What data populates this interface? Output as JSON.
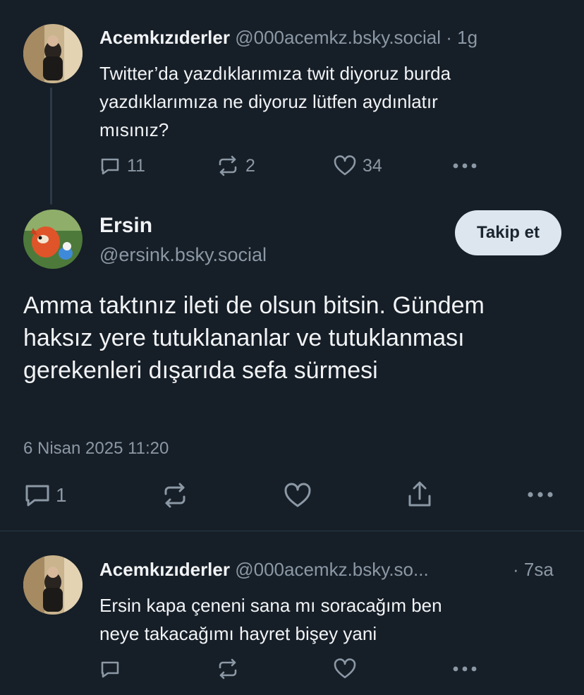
{
  "parent_post": {
    "display_name": "Acemkızıderler",
    "handle": "@000acemkz.bsky.social",
    "time": "· 1g",
    "text_lines": [
      "Twitter’da yazdıklarımıza twit diyoruz burda",
      "yazdıklarımıza ne diyoruz lütfen aydınlatır",
      "mısınız?"
    ],
    "reply_count": "11",
    "repost_count": "2",
    "like_count": "34"
  },
  "main_post": {
    "display_name": "Ersin",
    "handle": "@ersink.bsky.social",
    "follow_label": "Takip et",
    "text_lines": [
      "Amma taktınız ileti de olsun bitsin. Gündem",
      "haksız yere tutuklananlar ve tutuklanması",
      "gerekenleri dışarıda sefa sürmesi"
    ],
    "timestamp": "6 Nisan 2025 11:20",
    "reply_count": "1"
  },
  "reply_post": {
    "display_name": "Acemkızıderler",
    "handle": "@000acemkz.bsky.so...",
    "time": "· 7sa",
    "text_lines": [
      "Ersin kapa çeneni sana mı soracağım ben",
      "neye takacağımı hayret bişey yani"
    ]
  },
  "icons": {
    "reply": "reply-bubble-icon",
    "repost": "repost-icon",
    "like": "heart-icon",
    "share": "share-icon",
    "more": "more-dots-icon"
  },
  "colors": {
    "background": "#161e27",
    "text": "#f1f3f5",
    "muted": "#8b98a5",
    "follow_button_bg": "#dde6ee"
  }
}
